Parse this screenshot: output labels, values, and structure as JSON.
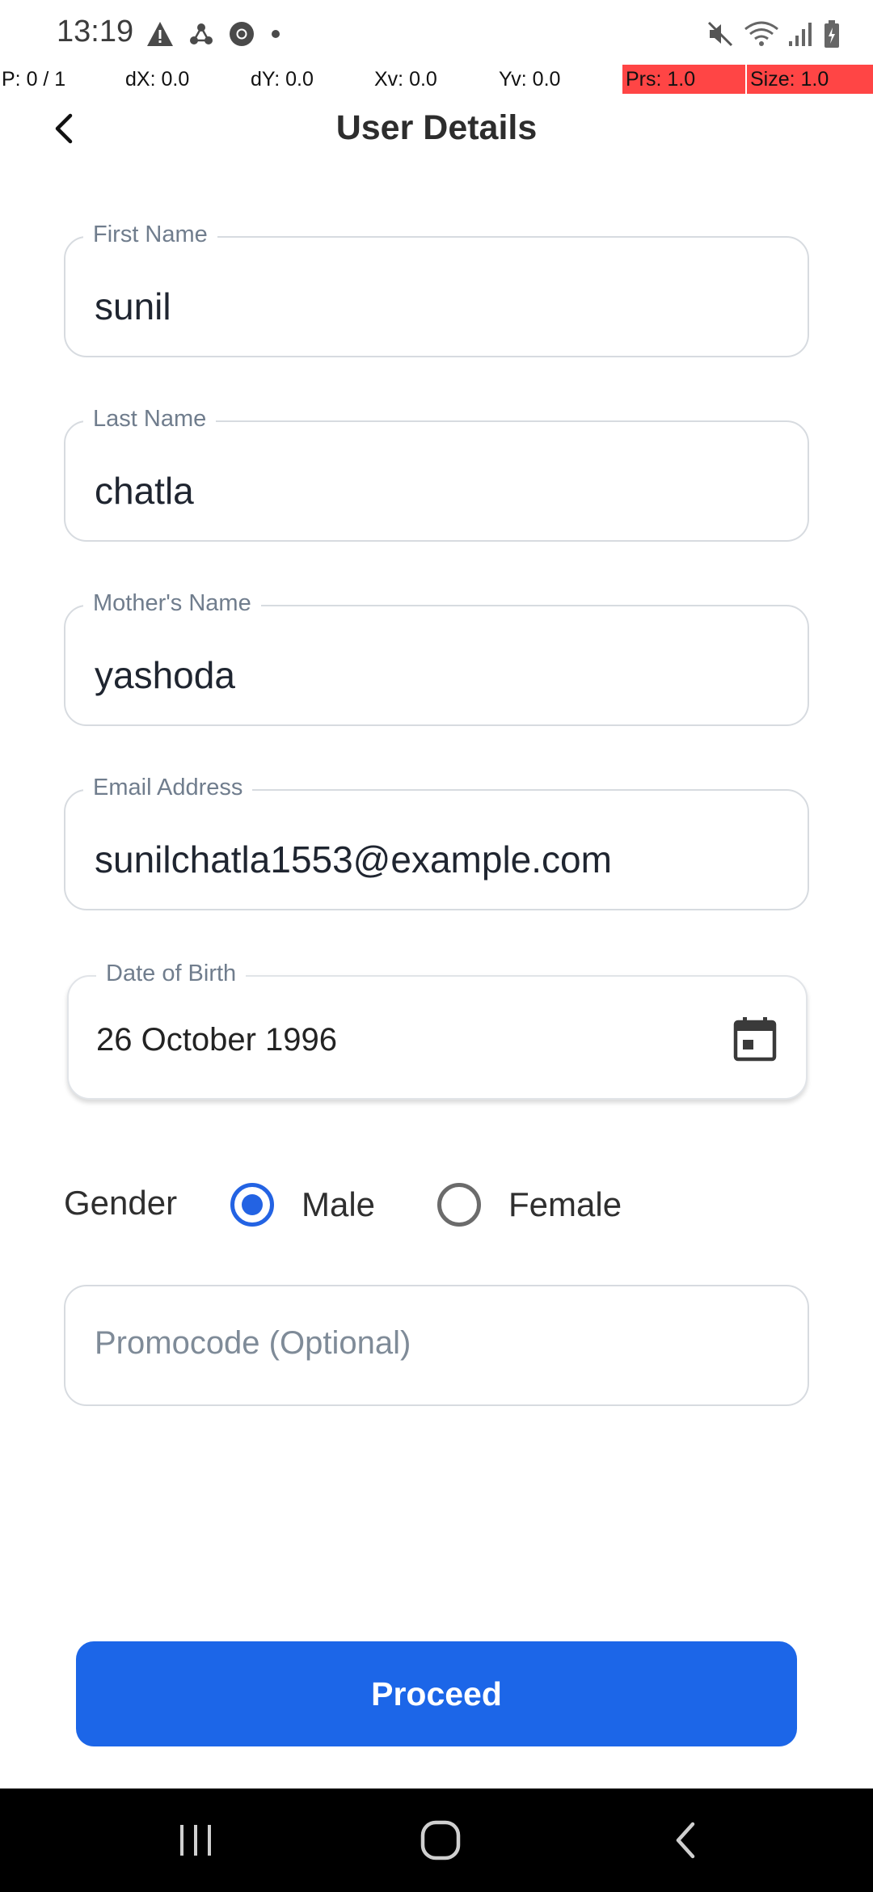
{
  "status_bar": {
    "time": "13:19",
    "left_icons": [
      "warning-icon",
      "share-nodes-icon",
      "chrome-icon",
      "dot-icon"
    ],
    "right_icons": [
      "mute-icon",
      "wifi-icon",
      "signal-icon",
      "battery-icon"
    ]
  },
  "debug_overlay": {
    "pointer": "P: 0 / 1",
    "dx": "dX: 0.0",
    "dy": "dY: 0.0",
    "xv": "Xv: 0.0",
    "yv": "Yv: 0.0",
    "prs": "Prs: 1.0",
    "size": "Size: 1.0",
    "highlight_color": "#ff4545"
  },
  "header": {
    "title": "User Details",
    "back_icon": "chevron-left-icon"
  },
  "form": {
    "first_name": {
      "label": "First Name",
      "value": "sunil"
    },
    "last_name": {
      "label": "Last Name",
      "value": "chatla"
    },
    "mothers_name": {
      "label": "Mother's Name",
      "value": "yashoda"
    },
    "email": {
      "label": "Email Address",
      "value": "sunilchatla1553@example.com"
    },
    "dob": {
      "label": "Date of Birth",
      "value": "26 October 1996",
      "icon": "calendar-icon"
    },
    "gender": {
      "label": "Gender",
      "options": [
        {
          "label": "Male",
          "selected": true
        },
        {
          "label": "Female",
          "selected": false
        }
      ]
    },
    "promocode": {
      "placeholder": "Promocode (Optional)",
      "value": ""
    }
  },
  "proceed_label": "Proceed",
  "colors": {
    "accent": "#1c66e8",
    "radio_selected": "#2363e3",
    "field_border": "#d7dbe0",
    "label": "#707d8d"
  },
  "nav_bar": {
    "icons": [
      "recent-apps-icon",
      "home-icon",
      "back-icon"
    ]
  }
}
